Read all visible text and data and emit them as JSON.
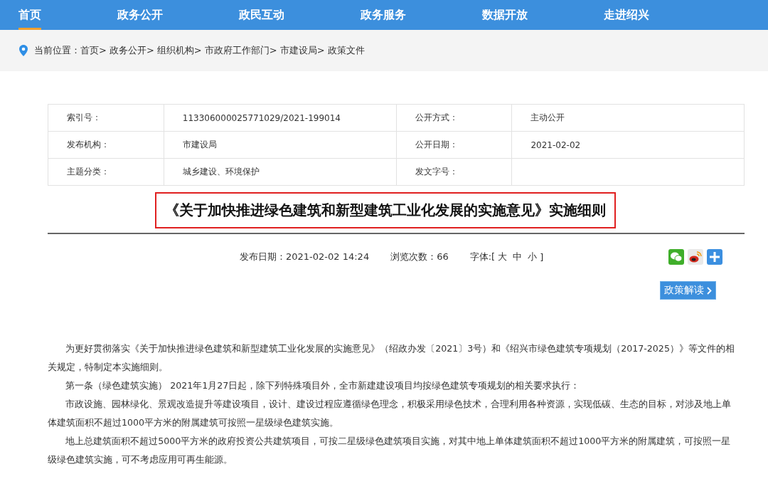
{
  "nav": [
    {
      "label": "首页",
      "selected": true
    },
    {
      "label": "政务公开",
      "selected": false
    },
    {
      "label": "政民互动",
      "selected": false
    },
    {
      "label": "政务服务",
      "selected": false
    },
    {
      "label": "数据开放",
      "selected": false
    },
    {
      "label": "走进绍兴",
      "selected": false
    }
  ],
  "breadcrumb": {
    "label": "当前位置：",
    "items": [
      "首页>",
      "政务公开>",
      "组织机构>",
      "市政府工作部门>",
      "市建设局>",
      "政策文件"
    ]
  },
  "info_table": [
    {
      "label": "索引号：",
      "value": "113306000025771029/2021-199014",
      "label_2": "公开方式：",
      "value_2": "主动公开"
    },
    {
      "label": "发布机构：",
      "value": "市建设局",
      "label_2": "公开日期：",
      "value_2": "2021-02-02"
    },
    {
      "label": "主题分类：",
      "value": "城乡建设、环境保护",
      "label_2": "发文字号："
    }
  ],
  "title": "《关于加快推进绿色建筑和新型建筑工业化发展的实施意见》实施细则",
  "meta": {
    "publish_date": "发布日期：2021-02-02 14:24",
    "views": "浏览次数：66",
    "font_label": "字体:[",
    "font_sizes": [
      "大",
      "中",
      "小"
    ],
    "font_close": "]"
  },
  "interpretation_button": "政策解读",
  "paragraphs": [
    "为更好贯彻落实《关于加快推进绿色建筑和新型建筑工业化发展的实施意见》（绍政办发〔2021〕3号）和《绍兴市绿色建筑专项规划（2017-2025）》等文件的相关规定，特制定本实施细则。",
    "第一条（绿色建筑实施） 2021年1月27日起，除下列特殊项目外，全市新建建设项目均按绿色建筑专项规划的相关要求执行：",
    "市政设施、园林绿化、景观改造提升等建设项目，设计、建设过程应遵循绿色理念，积极采用绿色技术，合理利用各种资源，实现低碳、生态的目标，对涉及地上单体建筑面积不超过1000平方米的附属建筑可按照一星级绿色建筑实施。",
    "地上总建筑面积不超过5000平方米的政府投资公共建筑项目，可按二星级绿色建筑项目实施，对其中地上单体建筑面积不超过1000平方米的附属建筑，可按照一星级绿色建筑实施，可不考虑应用可再生能源。"
  ]
}
